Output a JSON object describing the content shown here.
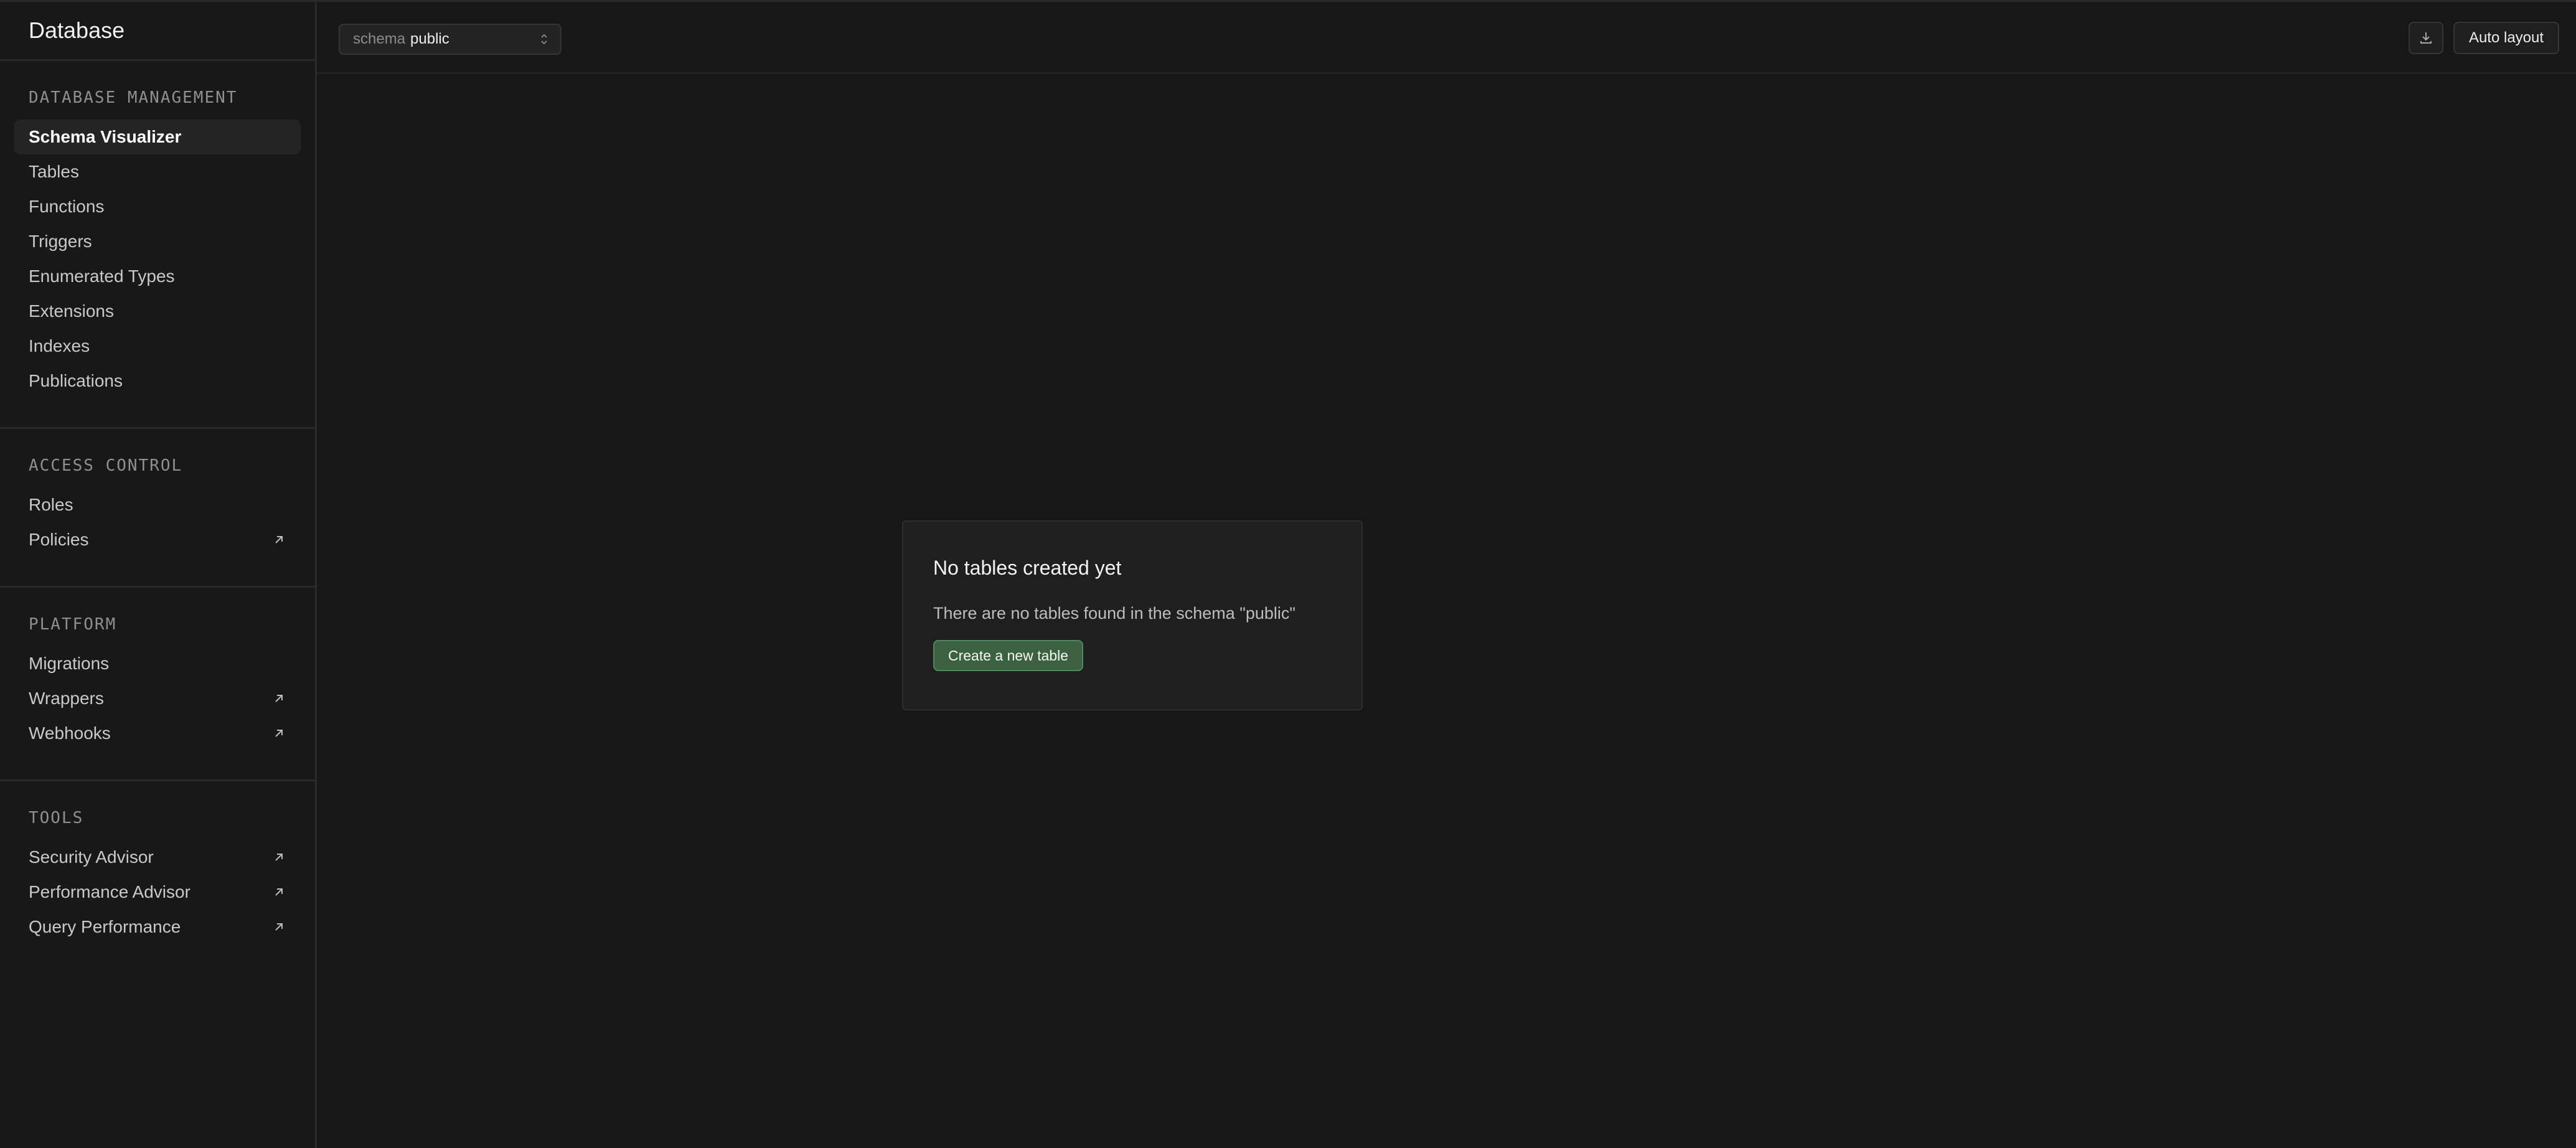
{
  "sidebar": {
    "title": "Database",
    "sections": [
      {
        "heading": "DATABASE MANAGEMENT",
        "items": [
          {
            "label": "Schema Visualizer",
            "active": true
          },
          {
            "label": "Tables"
          },
          {
            "label": "Functions"
          },
          {
            "label": "Triggers"
          },
          {
            "label": "Enumerated Types"
          },
          {
            "label": "Extensions"
          },
          {
            "label": "Indexes"
          },
          {
            "label": "Publications"
          }
        ]
      },
      {
        "heading": "ACCESS CONTROL",
        "items": [
          {
            "label": "Roles"
          },
          {
            "label": "Policies",
            "external": true
          }
        ]
      },
      {
        "heading": "PLATFORM",
        "items": [
          {
            "label": "Migrations"
          },
          {
            "label": "Wrappers",
            "external": true
          },
          {
            "label": "Webhooks",
            "external": true
          }
        ]
      },
      {
        "heading": "TOOLS",
        "items": [
          {
            "label": "Security Advisor",
            "external": true
          },
          {
            "label": "Performance Advisor",
            "external": true
          },
          {
            "label": "Query Performance",
            "external": true
          }
        ]
      }
    ]
  },
  "toolbar": {
    "schema_label": "schema",
    "schema_value": "public",
    "download_icon": "download-icon",
    "auto_layout_label": "Auto layout"
  },
  "empty_state": {
    "title": "No tables created yet",
    "description": "There are no tables found in the schema \"public\"",
    "button_label": "Create a new table"
  },
  "colors": {
    "background": "#171717",
    "sidebar_bg": "#181818",
    "active_item_bg": "#242424",
    "primary_button_bg": "#3b6140",
    "primary_button_border": "#4e8a57"
  }
}
